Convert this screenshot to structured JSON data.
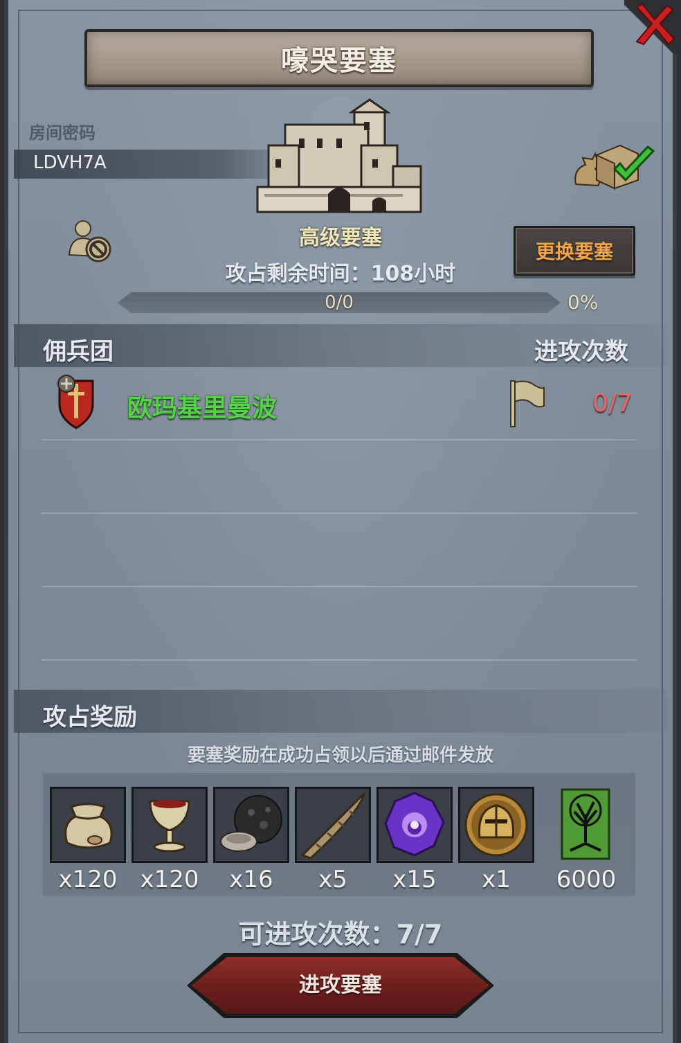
{
  "title": "嚎哭要塞",
  "room": {
    "label": "房间密码",
    "code": "LDVH7A"
  },
  "fortress": {
    "name": "高级要塞",
    "time_remaining": "攻占剩余时间：108小时",
    "progress_text": "0/0",
    "progress_value": 0,
    "progress_percent": "0%"
  },
  "change_button": "更换要塞",
  "mercenary": {
    "section_title": "佣兵团",
    "attack_count_header": "进攻次数",
    "rows": [
      {
        "name": "欧玛基里曼波",
        "count": "0/7"
      }
    ]
  },
  "rewards": {
    "section_title": "攻占奖励",
    "note": "要塞奖励在成功占领以后通过邮件发放",
    "items": [
      {
        "icon": "sack-icon",
        "count": "x120"
      },
      {
        "icon": "goblet-icon",
        "count": "x120"
      },
      {
        "icon": "ore-icon",
        "count": "x16"
      },
      {
        "icon": "horn-icon",
        "count": "x5"
      },
      {
        "icon": "purple-gem-icon",
        "count": "x15"
      },
      {
        "icon": "helmet-medal-icon",
        "count": "x1"
      },
      {
        "icon": "tree-banner-icon",
        "count": "6000"
      }
    ]
  },
  "attempts": "可进攻次数：7/7",
  "attack_button": "进攻要塞",
  "colors": {
    "mercenary_name": "#59d04d",
    "attack_count": "#e46a6a",
    "change_button_text": "#f2a64a"
  }
}
